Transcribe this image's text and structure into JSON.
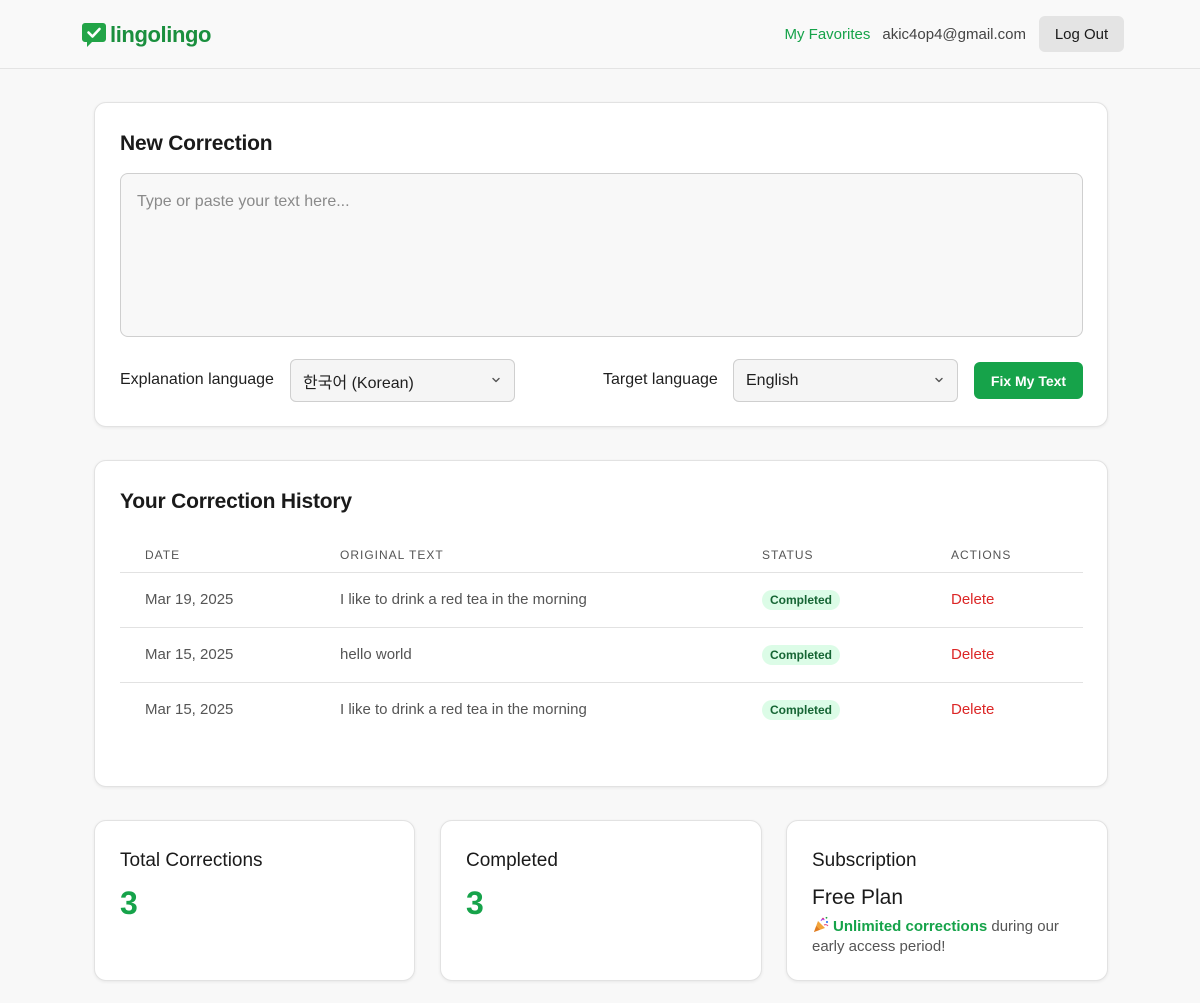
{
  "header": {
    "brand": "lingolingo",
    "favorites_label": "My Favorites",
    "user_email": "akic4op4@gmail.com",
    "logout_label": "Log Out"
  },
  "new_correction": {
    "title": "New Correction",
    "text_placeholder": "Type or paste your text here...",
    "text_value": "",
    "explanation_label": "Explanation language",
    "explanation_value": "한국어 (Korean)",
    "target_label": "Target language",
    "target_value": "English",
    "submit_label": "Fix My Text"
  },
  "history": {
    "title": "Your Correction History",
    "columns": [
      "DATE",
      "ORIGINAL TEXT",
      "STATUS",
      "ACTIONS"
    ],
    "rows": [
      {
        "date": "Mar 19, 2025",
        "text": "I like to drink a red tea in the morning",
        "status": "Completed",
        "action": "Delete"
      },
      {
        "date": "Mar 15, 2025",
        "text": "hello world",
        "status": "Completed",
        "action": "Delete"
      },
      {
        "date": "Mar 15, 2025",
        "text": "I like to drink a red tea in the morning",
        "status": "Completed",
        "action": "Delete"
      }
    ]
  },
  "stats": {
    "total_label": "Total Corrections",
    "total_value": "3",
    "completed_label": "Completed",
    "completed_value": "3",
    "subscription_label": "Subscription",
    "plan_name": "Free Plan",
    "plan_highlight": "Unlimited corrections",
    "plan_note": " during our early access period!"
  },
  "icons": {
    "brand": "chat-check-icon",
    "select_arrow": "chevron-down-icon",
    "celebration": "party-popper-icon"
  },
  "colors": {
    "accent": "#16a34a",
    "danger": "#dc2626",
    "badge_bg": "#dcfce7",
    "badge_text": "#166534"
  }
}
